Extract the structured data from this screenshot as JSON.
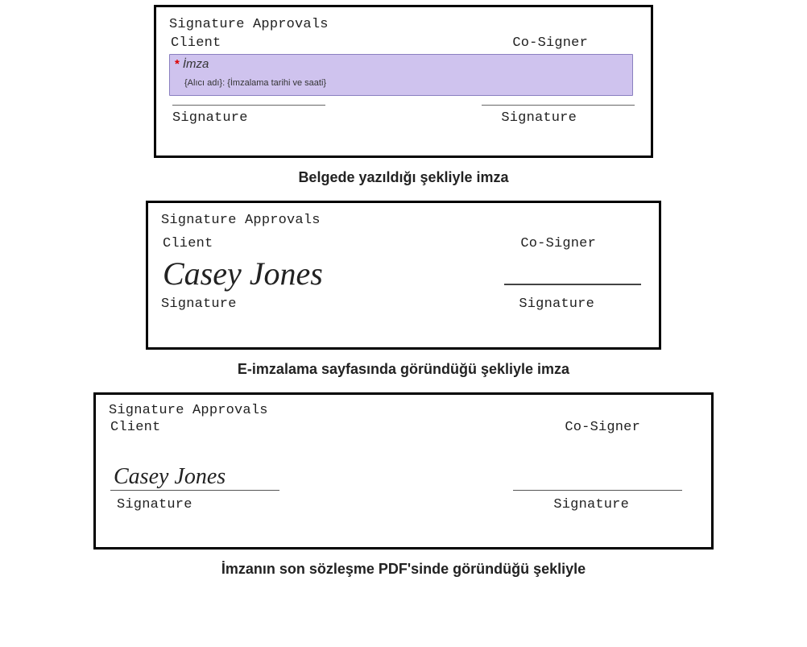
{
  "box1": {
    "title": "Signature Approvals",
    "client_label": "Client",
    "cosigner_label": "Co-Signer",
    "sig_field": {
      "required_mark": "*",
      "label": "İmza",
      "placeholder": "{Alıcı adı}: {İmzalama tarihi ve saati}"
    },
    "signature_caption_left": "Signature",
    "signature_caption_right": "Signature"
  },
  "caption1": "Belgede yazıldığı şekliyle imza",
  "box2": {
    "title": "Signature Approvals",
    "client_label": "Client",
    "cosigner_label": "Co-Signer",
    "signed_name": "Casey Jones",
    "signature_caption_left": "Signature",
    "signature_caption_right": "Signature"
  },
  "caption2": "E-imzalama sayfasında göründüğü şekliyle imza",
  "box3": {
    "title": "Signature Approvals",
    "client_label": "Client",
    "cosigner_label": "Co-Signer",
    "signed_name": "Casey Jones",
    "signature_caption_left": "Signature",
    "signature_caption_right": "Signature"
  },
  "caption3": "İmzanın son sözleşme PDF'sinde göründüğü şekliyle"
}
